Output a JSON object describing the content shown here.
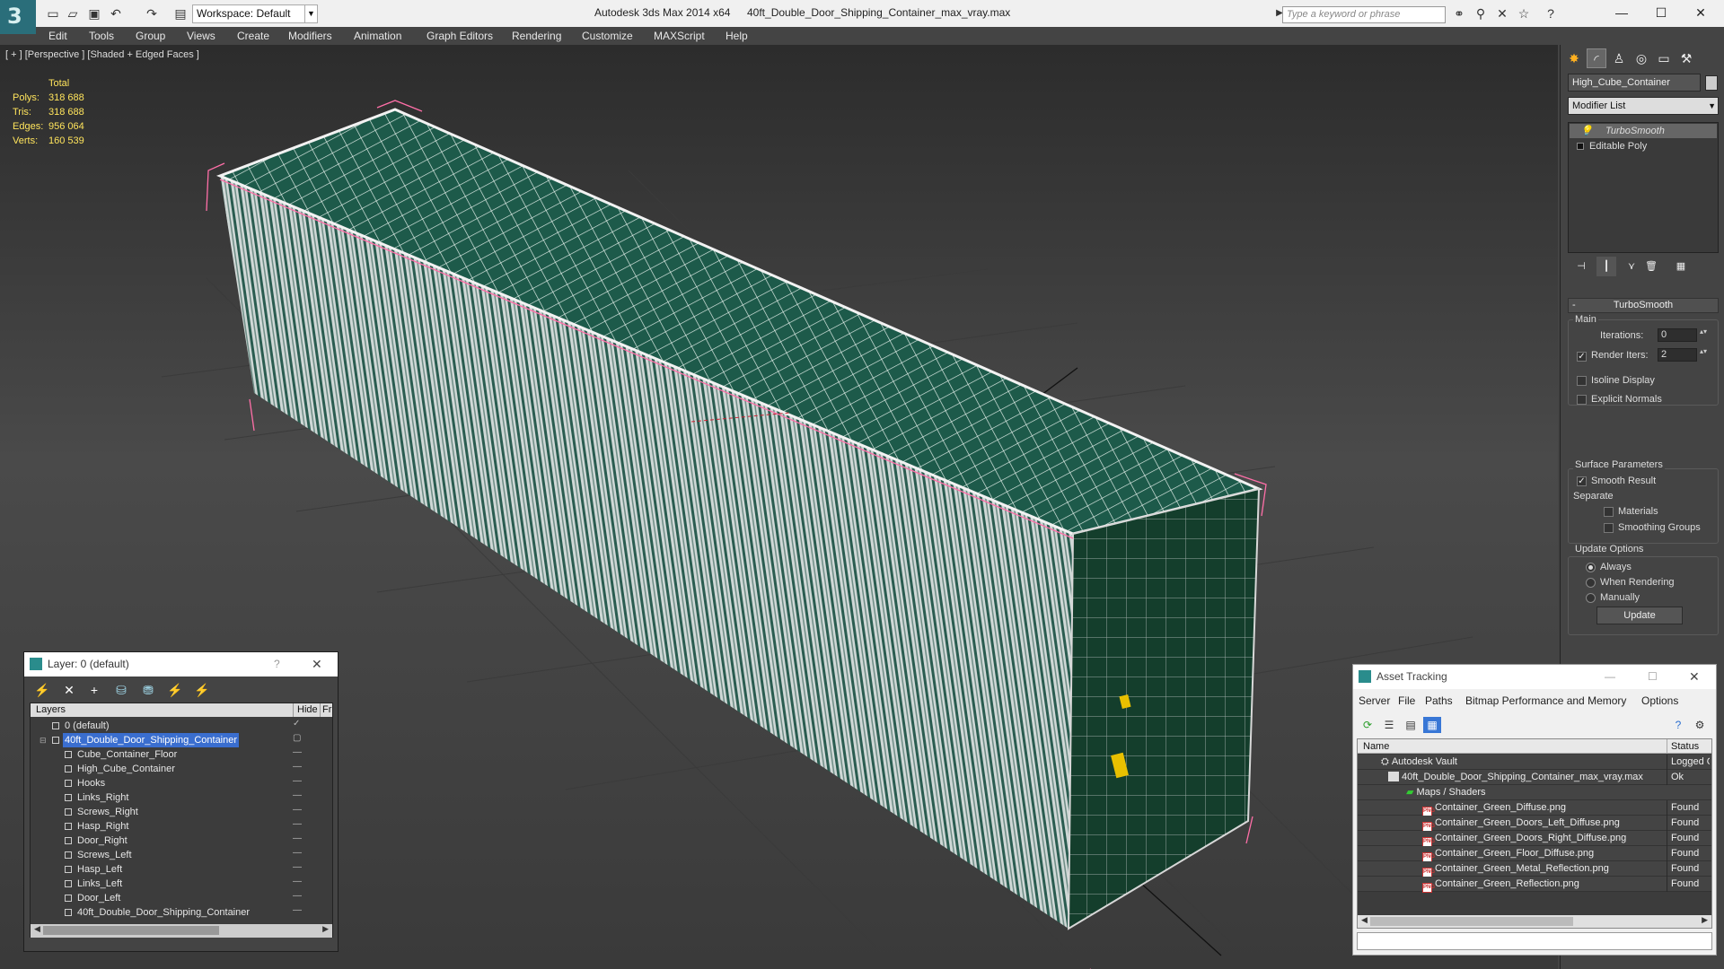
{
  "titlebar": {
    "workspace": "Workspace: Default",
    "app_title": "Autodesk 3ds Max  2014 x64",
    "file_title": "40ft_Double_Door_Shipping_Container_max_vray.max",
    "search_placeholder": "Type a keyword or phrase"
  },
  "menu": [
    "Edit",
    "Tools",
    "Group",
    "Views",
    "Create",
    "Modifiers",
    "Animation",
    "Graph Editors",
    "Rendering",
    "Customize",
    "MAXScript",
    "Help"
  ],
  "viewport": {
    "label": "[ + ] [Perspective ] [Shaded + Edged Faces ]",
    "stats": {
      "header": "Total",
      "rows": [
        {
          "label": "Polys:",
          "value": "318 688"
        },
        {
          "label": "Tris:",
          "value": "318 688"
        },
        {
          "label": "Edges:",
          "value": "956 064"
        },
        {
          "label": "Verts:",
          "value": "160 539"
        }
      ]
    }
  },
  "command_panel": {
    "object_name": "High_Cube_Container",
    "modifier_list": "Modifier List",
    "stack": [
      "TurboSmooth",
      "Editable Poly"
    ],
    "turbosmooth": {
      "title": "TurboSmooth",
      "main": "Main",
      "iterations_label": "Iterations:",
      "iterations_value": "0",
      "render_iters_label": "Render Iters:",
      "render_iters_value": "2",
      "isoline": "Isoline Display",
      "explicit_normals": "Explicit Normals",
      "surface_params": "Surface Parameters",
      "smooth_result": "Smooth Result",
      "separate": "Separate",
      "materials": "Materials",
      "smoothing_groups": "Smoothing Groups",
      "update_options": "Update Options",
      "always": "Always",
      "when_rendering": "When Rendering",
      "manually": "Manually",
      "update_button": "Update"
    }
  },
  "layer_dialog": {
    "title": "Layer: 0 (default)",
    "col_layers": "Layers",
    "col_hide": "Hide",
    "col_f": "Fr",
    "rows": [
      {
        "name": "0 (default)",
        "level": 0
      },
      {
        "name": "40ft_Double_Door_Shipping_Container",
        "level": 0,
        "selected": true
      },
      {
        "name": "Cube_Container_Floor",
        "level": 1
      },
      {
        "name": "High_Cube_Container",
        "level": 1
      },
      {
        "name": "Hooks",
        "level": 1
      },
      {
        "name": "Links_Right",
        "level": 1
      },
      {
        "name": "Screws_Right",
        "level": 1
      },
      {
        "name": "Hasp_Right",
        "level": 1
      },
      {
        "name": "Door_Right",
        "level": 1
      },
      {
        "name": "Screws_Left",
        "level": 1
      },
      {
        "name": "Hasp_Left",
        "level": 1
      },
      {
        "name": "Links_Left",
        "level": 1
      },
      {
        "name": "Door_Left",
        "level": 1
      },
      {
        "name": "40ft_Double_Door_Shipping_Container",
        "level": 1
      }
    ]
  },
  "asset_dialog": {
    "title": "Asset Tracking",
    "menu": [
      "Server",
      "File",
      "Paths",
      "Bitmap Performance and Memory",
      "Options"
    ],
    "col_name": "Name",
    "col_status": "Status",
    "rows": [
      {
        "name": "Autodesk Vault",
        "status": "Logged Out",
        "level": 0
      },
      {
        "name": "40ft_Double_Door_Shipping_Container_max_vray.max",
        "status": "Ok",
        "level": 1
      },
      {
        "name": "Maps / Shaders",
        "status": "",
        "level": 2
      },
      {
        "name": "Container_Green_Diffuse.png",
        "status": "Found",
        "level": 3
      },
      {
        "name": "Container_Green_Doors_Left_Diffuse.png",
        "status": "Found",
        "level": 3
      },
      {
        "name": "Container_Green_Doors_Right_Diffuse.png",
        "status": "Found",
        "level": 3
      },
      {
        "name": "Container_Green_Floor_Diffuse.png",
        "status": "Found",
        "level": 3
      },
      {
        "name": "Container_Green_Metal_Reflection.png",
        "status": "Found",
        "level": 3
      },
      {
        "name": "Container_Green_Reflection.png",
        "status": "Found",
        "level": 3
      }
    ]
  }
}
